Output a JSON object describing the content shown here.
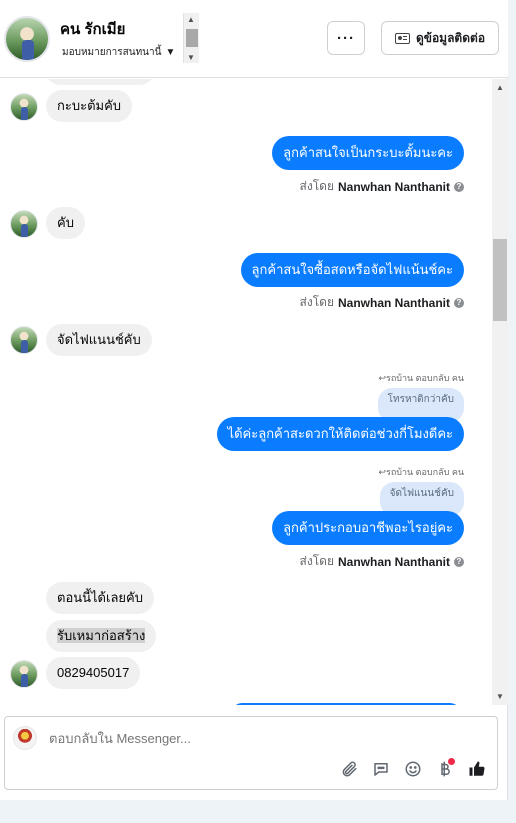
{
  "header": {
    "contact_name": "คน รักเมีย",
    "assign_label": "มอบหมายการสนทนานี้",
    "more_label": "···",
    "contact_info_label": "ดูข้อมูลติดต่อ"
  },
  "messages": [
    {
      "type": "in",
      "text": "กะบะต้มคับ"
    },
    {
      "type": "out",
      "text": "ลูกค้าสนใจเป็นกระบะตั้มนะคะ",
      "sent_prefix": "ส่งโดย",
      "sender": "Nanwhan Nanthanit"
    },
    {
      "type": "in",
      "text": "คับ"
    },
    {
      "type": "out",
      "text": "ลูกค้าสนใจซื้อสดหรือจัดไฟแน้นช์คะ",
      "sent_prefix": "ส่งโดย",
      "sender": "Nanwhan Nanthanit"
    },
    {
      "type": "in",
      "text": "จัดไฟแนนช์คับ"
    },
    {
      "type": "out_reply",
      "reply_note": "↩รถบ้าน ตอบกลับ คน",
      "quote": "โทรหาดิกว่าคับ",
      "text": "ได้ค่ะลูกค้าสะดวกให้ติดต่อช่วงกี่โมงดีคะ"
    },
    {
      "type": "out_reply",
      "reply_note": "↩รถบ้าน ตอบกลับ คน",
      "quote": "จัดไฟแนนช์คับ",
      "text": "ลูกค้าประกอบอาชีพอะไรอยู่คะ",
      "sent_prefix": "ส่งโดย",
      "sender": "Nanwhan Nanthanit"
    },
    {
      "type": "in",
      "text": "ตอนนี้ได้เลยคับ"
    },
    {
      "type": "in",
      "text": "รับเหมาก่อสร้าง"
    },
    {
      "type": "in",
      "text": "0829405017"
    }
  ],
  "composer": {
    "placeholder": "ตอบกลับใน Messenger..."
  },
  "icons": {
    "attach": "paperclip-icon",
    "saved_reply": "chat-bubble-icon",
    "emoji": "emoji-icon",
    "payment": "baht-icon",
    "like": "thumbs-up-icon"
  },
  "colors": {
    "outgoing_bubble": "#0a7cff",
    "incoming_bubble": "#f0f0f0",
    "quote_bubble": "#dbe8fb",
    "notification_dot": "#f02849"
  }
}
